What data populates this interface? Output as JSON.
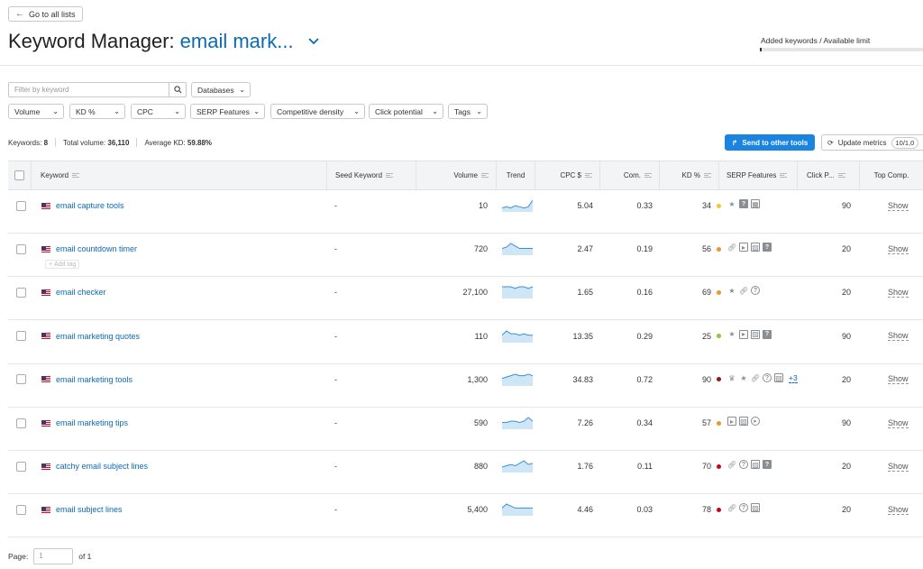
{
  "back_label": "Go to all lists",
  "title_prefix": "Keyword Manager:",
  "list_name": "email mark...",
  "limit_label": "Added keywords / Available limit",
  "limit_fraction": 0.01,
  "filter_placeholder": "Filter by keyword",
  "filters_row1": [
    "Databases"
  ],
  "filters_row2": [
    "Volume",
    "KD %",
    "CPC",
    "SERP Features",
    "Competitive density",
    "Click potential",
    "Tags"
  ],
  "summary": {
    "keywords_label": "Keywords:",
    "keywords_value": "8",
    "volume_label": "Total volume:",
    "volume_value": "36,110",
    "kd_label": "Average KD:",
    "kd_value": "59.88%"
  },
  "send_label": "Send to other tools",
  "update_label": "Update metrics",
  "update_count": "10/1,0",
  "columns": {
    "keyword": "Keyword",
    "seed": "Seed Keyword",
    "volume": "Volume",
    "trend": "Trend",
    "cpc": "CPC $",
    "com": "Com.",
    "kd": "KD %",
    "serp": "SERP Features",
    "click": "Click P...",
    "top": "Top Comp."
  },
  "add_tag_label": "Add tag",
  "show_label": "Show",
  "rows": [
    {
      "keyword": "email capture tools",
      "seed": "-",
      "volume": "10",
      "cpc": "5.04",
      "com": "0.33",
      "kd": "34",
      "kd_color": "#f5c52b",
      "click": "90",
      "trend": [
        2,
        3,
        2,
        4,
        3,
        2,
        3,
        9
      ],
      "serp": [
        "star",
        "faq",
        "image-pack"
      ],
      "more": ""
    },
    {
      "keyword": "email countdown timer",
      "seed": "-",
      "volume": "720",
      "cpc": "2.47",
      "com": "0.19",
      "kd": "56",
      "kd_color": "#e59a2b",
      "click": "20",
      "trend": [
        4,
        5,
        8,
        6,
        4,
        4,
        4,
        4
      ],
      "serp": [
        "link",
        "video",
        "image",
        "faq"
      ],
      "more": ""
    },
    {
      "keyword": "email checker",
      "seed": "-",
      "volume": "27,100",
      "cpc": "1.65",
      "com": "0.16",
      "kd": "69",
      "kd_color": "#e59a2b",
      "click": "20",
      "trend": [
        6,
        6,
        6,
        5,
        6,
        6,
        5,
        6
      ],
      "serp": [
        "star",
        "link",
        "question"
      ],
      "more": ""
    },
    {
      "keyword": "email marketing quotes",
      "seed": "-",
      "volume": "110",
      "cpc": "13.35",
      "com": "0.29",
      "kd": "25",
      "kd_color": "#8dc63f",
      "click": "90",
      "trend": [
        4,
        7,
        5,
        5,
        4,
        5,
        4,
        4
      ],
      "serp": [
        "star",
        "video",
        "image",
        "faq"
      ],
      "more": ""
    },
    {
      "keyword": "email marketing tools",
      "seed": "-",
      "volume": "1,300",
      "cpc": "34.83",
      "com": "0.72",
      "kd": "90",
      "kd_color": "#8b1a1a",
      "click": "20",
      "trend": [
        4,
        5,
        6,
        7,
        6,
        6,
        7,
        6
      ],
      "serp": [
        "crown",
        "star",
        "link",
        "question",
        "image"
      ],
      "more": "+3"
    },
    {
      "keyword": "email marketing tips",
      "seed": "-",
      "volume": "590",
      "cpc": "7.26",
      "com": "0.34",
      "kd": "57",
      "kd_color": "#e59a2b",
      "click": "90",
      "trend": [
        4,
        4,
        5,
        5,
        4,
        5,
        8,
        5
      ],
      "serp": [
        "video",
        "image",
        "play"
      ],
      "more": ""
    },
    {
      "keyword": "catchy email subject lines",
      "seed": "-",
      "volume": "880",
      "cpc": "1.76",
      "com": "0.11",
      "kd": "70",
      "kd_color": "#d0021b",
      "click": "20",
      "trend": [
        3,
        4,
        5,
        4,
        6,
        8,
        5,
        6
      ],
      "serp": [
        "link",
        "question",
        "image",
        "faq"
      ],
      "more": ""
    },
    {
      "keyword": "email subject lines",
      "seed": "-",
      "volume": "5,400",
      "cpc": "4.46",
      "com": "0.03",
      "kd": "78",
      "kd_color": "#d0021b",
      "click": "20",
      "trend": [
        3,
        5,
        4,
        3,
        3,
        3,
        3,
        3
      ],
      "serp": [
        "link",
        "question",
        "image"
      ],
      "more": ""
    }
  ],
  "pager": {
    "label": "Page:",
    "value": "1",
    "of_label": "of 1"
  }
}
